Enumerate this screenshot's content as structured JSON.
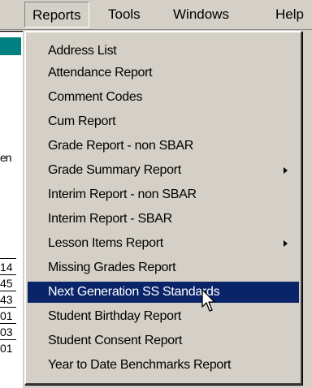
{
  "menubar": {
    "items": [
      {
        "label": "Reports",
        "active": true
      },
      {
        "label": "Tools"
      },
      {
        "label": "Windows"
      },
      {
        "label": "Help"
      }
    ]
  },
  "background": {
    "label_fragment": "en",
    "row_fragments": [
      "14",
      "45",
      "43",
      "01",
      "03",
      "01"
    ]
  },
  "reports_menu": {
    "items": [
      {
        "label": "Address List"
      },
      {
        "label": "Attendance Report"
      },
      {
        "label": "Comment Codes"
      },
      {
        "label": "Cum Report"
      },
      {
        "label": "Grade Report - non SBAR"
      },
      {
        "label": "Grade Summary Report",
        "has_submenu": true
      },
      {
        "label": "Interim Report - non SBAR"
      },
      {
        "label": "Interim Report - SBAR"
      },
      {
        "label": "Lesson Items Report",
        "has_submenu": true
      },
      {
        "label": "Missing Grades Report"
      },
      {
        "label": "Next Generation SS Standards",
        "highlighted": true
      },
      {
        "label": "Student Birthday Report"
      },
      {
        "label": "Student Consent Report"
      },
      {
        "label": "Year to Date Benchmarks Report"
      }
    ]
  },
  "colors": {
    "highlight": "#0a246a",
    "menu_bg": "#d4d0c8",
    "accent_teal": "#008080"
  },
  "icons": {
    "submenu": "triangle-right-icon",
    "pointer": "mouse-pointer-icon"
  }
}
